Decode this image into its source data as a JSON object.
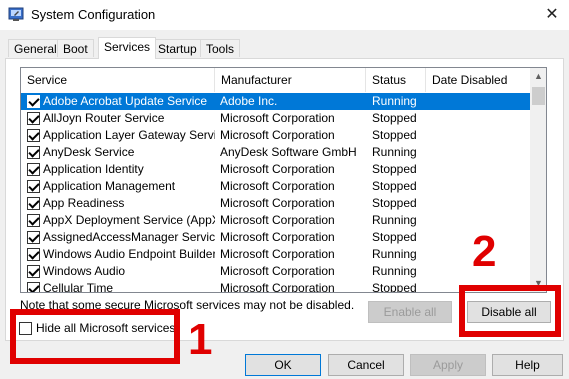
{
  "window": {
    "title": "System Configuration",
    "close_glyph": "✕"
  },
  "tabs": [
    {
      "label": "General",
      "active": false
    },
    {
      "label": "Boot",
      "active": false
    },
    {
      "label": "Services",
      "active": true
    },
    {
      "label": "Startup",
      "active": false
    },
    {
      "label": "Tools",
      "active": false
    }
  ],
  "services_table": {
    "columns": [
      "Service",
      "Manufacturer",
      "Status",
      "Date Disabled"
    ],
    "rows": [
      {
        "checked": true,
        "service": "Adobe Acrobat Update Service",
        "manufacturer": "Adobe Inc.",
        "status": "Running",
        "date_disabled": "",
        "selected": true
      },
      {
        "checked": true,
        "service": "AllJoyn Router Service",
        "manufacturer": "Microsoft Corporation",
        "status": "Stopped",
        "date_disabled": ""
      },
      {
        "checked": true,
        "service": "Application Layer Gateway Service",
        "manufacturer": "Microsoft Corporation",
        "status": "Stopped",
        "date_disabled": ""
      },
      {
        "checked": true,
        "service": "AnyDesk Service",
        "manufacturer": "AnyDesk Software GmbH",
        "status": "Running",
        "date_disabled": ""
      },
      {
        "checked": true,
        "service": "Application Identity",
        "manufacturer": "Microsoft Corporation",
        "status": "Stopped",
        "date_disabled": ""
      },
      {
        "checked": true,
        "service": "Application Management",
        "manufacturer": "Microsoft Corporation",
        "status": "Stopped",
        "date_disabled": ""
      },
      {
        "checked": true,
        "service": "App Readiness",
        "manufacturer": "Microsoft Corporation",
        "status": "Stopped",
        "date_disabled": ""
      },
      {
        "checked": true,
        "service": "AppX Deployment Service (AppX...",
        "manufacturer": "Microsoft Corporation",
        "status": "Running",
        "date_disabled": ""
      },
      {
        "checked": true,
        "service": "AssignedAccessManager Service",
        "manufacturer": "Microsoft Corporation",
        "status": "Stopped",
        "date_disabled": ""
      },
      {
        "checked": true,
        "service": "Windows Audio Endpoint Builder",
        "manufacturer": "Microsoft Corporation",
        "status": "Running",
        "date_disabled": ""
      },
      {
        "checked": true,
        "service": "Windows Audio",
        "manufacturer": "Microsoft Corporation",
        "status": "Running",
        "date_disabled": ""
      },
      {
        "checked": true,
        "service": "Cellular Time",
        "manufacturer": "Microsoft Corporation",
        "status": "Stopped",
        "date_disabled": ""
      }
    ]
  },
  "note": "Note that some secure Microsoft services may not be disabled.",
  "hide_ms_services": {
    "label": "Hide all Microsoft services",
    "checked": false
  },
  "buttons": {
    "enable_all": "Enable all",
    "disable_all": "Disable all",
    "ok": "OK",
    "cancel": "Cancel",
    "apply": "Apply",
    "help": "Help"
  },
  "annotations": {
    "one": "1",
    "two": "2"
  },
  "colors": {
    "selection": "#0078d7",
    "annotation_red": "#e00000"
  },
  "icons": {
    "app": "msconfig-icon",
    "close": "close-icon",
    "scroll_up": "scroll-up-arrow-icon",
    "scroll_down": "scroll-down-arrow-icon"
  }
}
